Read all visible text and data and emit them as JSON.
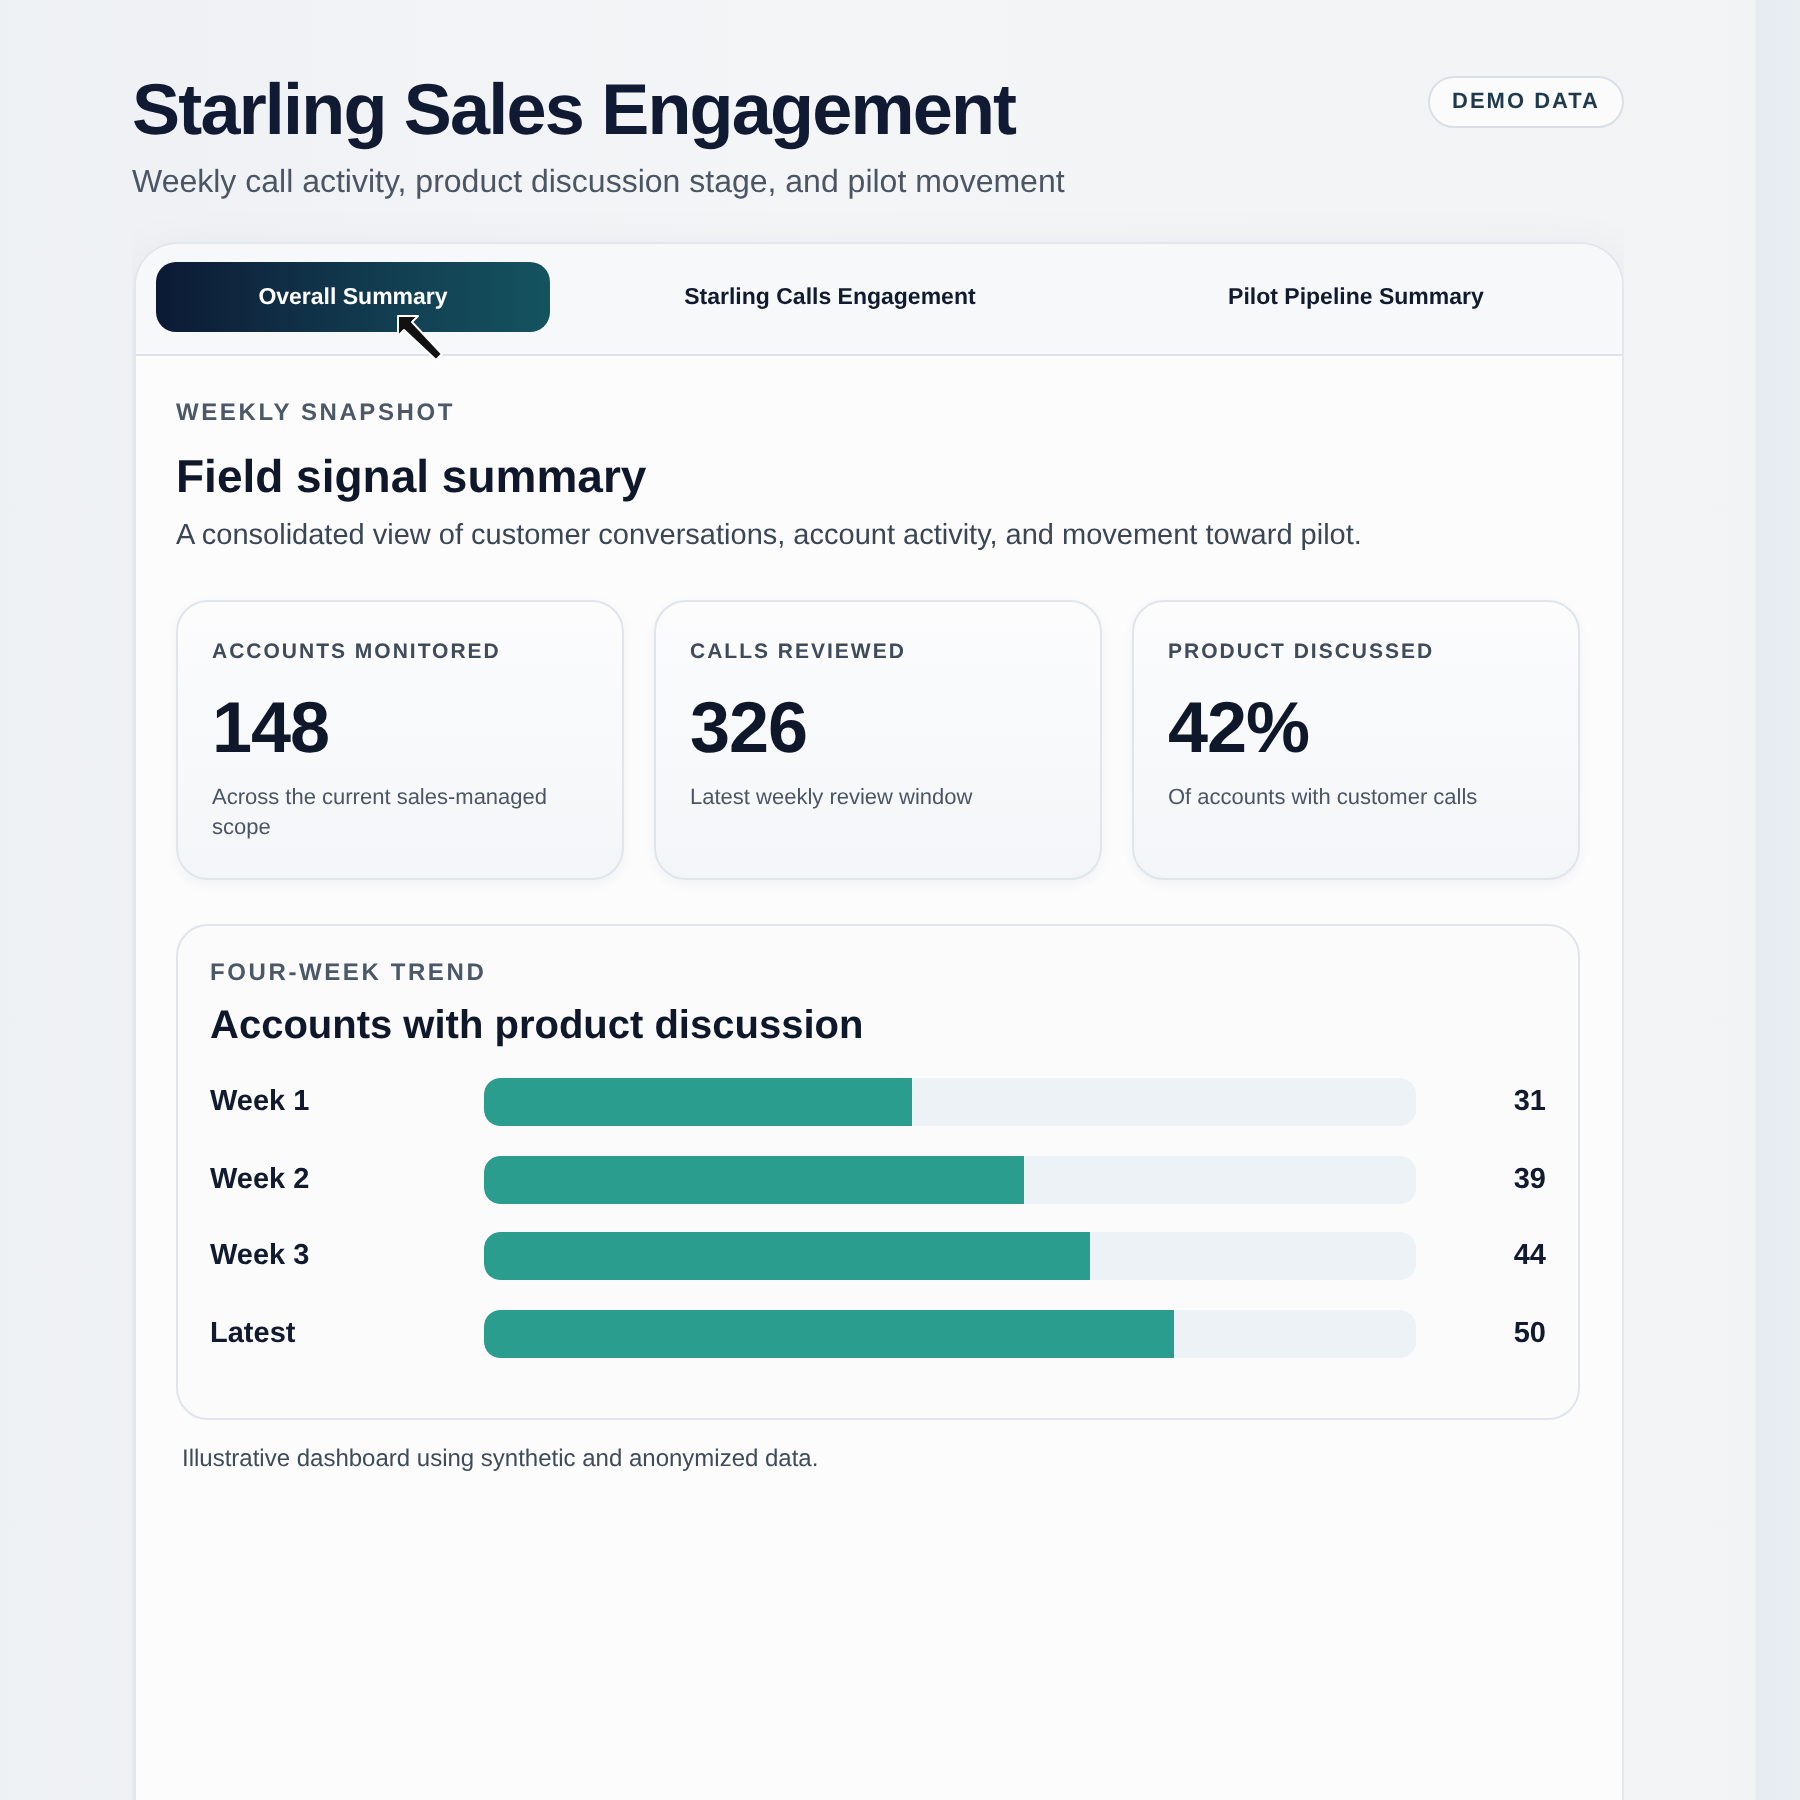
{
  "header": {
    "title": "Starling Sales Engagement",
    "subtitle": "Weekly call activity, product discussion stage, and pilot movement",
    "badge": "DEMO DATA"
  },
  "tabs": [
    {
      "label": "Overall Summary",
      "selected": true
    },
    {
      "label": "Starling Calls Engagement",
      "selected": false
    },
    {
      "label": "Pilot Pipeline Summary",
      "selected": false
    }
  ],
  "snapshot": {
    "eyebrow": "WEEKLY SNAPSHOT",
    "title": "Field signal summary",
    "description": "A consolidated view of customer conversations, account activity, and movement toward pilot."
  },
  "stats": [
    {
      "label": "ACCOUNTS MONITORED",
      "value": "148",
      "caption": "Across the current sales-managed scope"
    },
    {
      "label": "CALLS REVIEWED",
      "value": "326",
      "caption": "Latest weekly review window"
    },
    {
      "label": "PRODUCT DISCUSSED",
      "value": "42%",
      "caption": "Of accounts with customer calls"
    }
  ],
  "trend": {
    "eyebrow": "FOUR-WEEK TREND",
    "title": "Accounts with product discussion",
    "rows": [
      {
        "label": "Week 1",
        "level": 0.46,
        "value": "31"
      },
      {
        "label": "Week 2",
        "level": 0.58,
        "value": "39"
      },
      {
        "label": "Week 3",
        "level": 0.65,
        "value": "44"
      },
      {
        "label": "Latest",
        "level": 0.74,
        "value": "50"
      }
    ]
  },
  "footnote": "Illustrative dashboard using synthetic and anonymized data."
}
